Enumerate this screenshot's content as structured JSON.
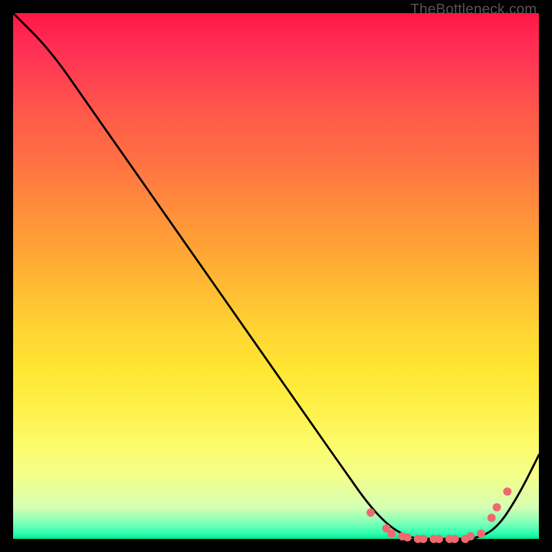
{
  "attribution": "TheBottleneck.com",
  "colors": {
    "frame": "#000000",
    "curve": "#000000",
    "dots": "#ee6a6f",
    "green_band": "#21e39b"
  },
  "chart_data": {
    "type": "line",
    "title": "",
    "xlabel": "",
    "ylabel": "",
    "xlim": [
      0,
      100
    ],
    "ylim": [
      0,
      100
    ],
    "series": [
      {
        "name": "bottleneck-curve",
        "x": [
          0,
          7,
          14,
          21,
          28,
          35,
          42,
          49,
          56,
          63,
          68,
          72,
          76,
          80,
          84,
          88,
          92,
          96,
          100
        ],
        "y": [
          100,
          93,
          83,
          73,
          63,
          53,
          43,
          33,
          23,
          13,
          6,
          2,
          0,
          0,
          0,
          0,
          2,
          8,
          16
        ]
      }
    ],
    "highlight_points": {
      "name": "optimal-range-dots",
      "x": [
        68,
        71,
        72,
        74,
        75,
        77,
        78,
        80,
        81,
        83,
        84,
        86,
        87,
        89,
        91,
        92,
        94
      ],
      "y": [
        5,
        2,
        1,
        0.5,
        0.3,
        0,
        0,
        0,
        0,
        0,
        0,
        0,
        0.5,
        1,
        4,
        6,
        9
      ]
    },
    "background_gradient": {
      "direction": "top-to-bottom",
      "stops": [
        {
          "pos": 0.0,
          "color": "#ff1744"
        },
        {
          "pos": 0.5,
          "color": "#ffd333"
        },
        {
          "pos": 0.88,
          "color": "#f4fe8a"
        },
        {
          "pos": 0.99,
          "color": "#2bffb0"
        },
        {
          "pos": 1.0,
          "color": "#00e690"
        }
      ]
    }
  }
}
